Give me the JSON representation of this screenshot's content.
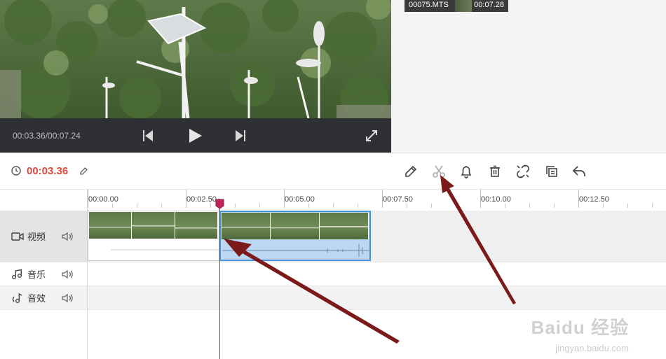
{
  "player": {
    "time_readout": "00:03.36/00:07.24"
  },
  "media_panel": {
    "item_name": "00075.MTS",
    "item_duration": "00:07.28"
  },
  "toolbar": {
    "current_time": "00:03.36",
    "current_time_color": "#e0473d",
    "tools": [
      "pencil-icon",
      "scissors-icon",
      "bell-icon",
      "trash-icon",
      "unlink-icon",
      "copy-icon",
      "undo-icon"
    ]
  },
  "ruler": {
    "ticks": [
      "00:00.00",
      "00:02.50",
      "00:05.00",
      "00:07.50",
      "00:10.00",
      "00:12.50"
    ]
  },
  "tracks": {
    "video": "视频",
    "music": "音乐",
    "sfx": "音效"
  },
  "watermark": {
    "brand": "Baidu 经验",
    "url": "jingyan.baidu.com"
  },
  "colors": {
    "accent_red": "#e0473d",
    "selected_clip_border": "#4a90d9",
    "playhead": "#a0336b",
    "annotation_arrow": "#7a1a1a"
  }
}
